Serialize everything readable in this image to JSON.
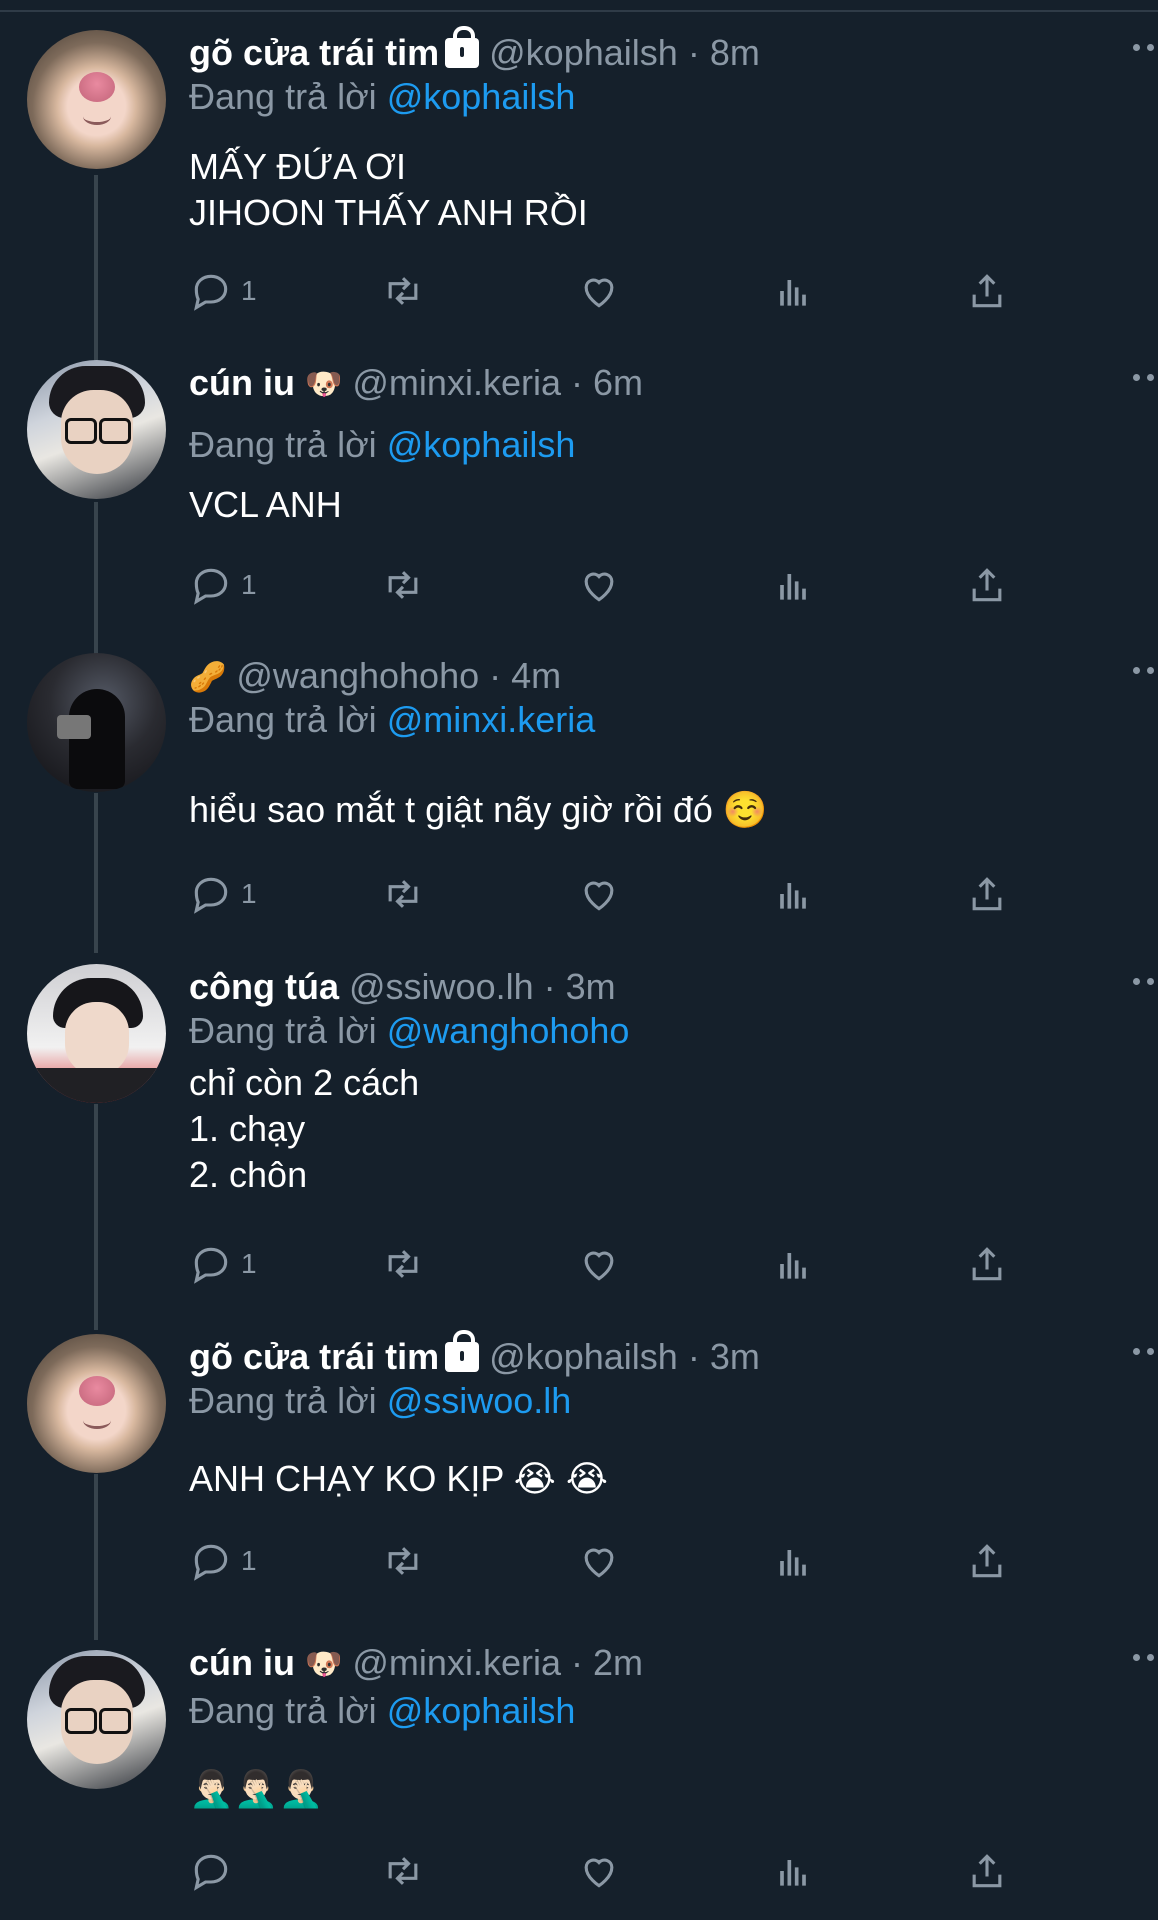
{
  "tweets": [
    {
      "name": "gõ cửa trái tim",
      "handle": "@kophailsh",
      "time": "8m",
      "replying_prefix": "Đang trả lời",
      "replying_to": "@kophailsh",
      "text": " MẤY ĐỨA ƠI\nJIHOON THẤY ANH RỒI",
      "reply_count": "1",
      "name_emoji": "",
      "avatar": "cat"
    },
    {
      "name": "cún iu",
      "handle": "@minxi.keria",
      "time": "6m",
      "replying_prefix": "Đang trả lời",
      "replying_to": "@kophailsh",
      "text": "VCL ANH",
      "reply_count": "1",
      "name_emoji": "🐶",
      "avatar": "glasses"
    },
    {
      "name": "",
      "handle": "@wanghohoho",
      "time": "4m",
      "replying_prefix": "Đang trả lời",
      "replying_to": "@minxi.keria",
      "text": "hiểu sao mắt t giật nãy giờ rồi đó ☺️",
      "reply_count": "1",
      "name_emoji": "🥜",
      "avatar": "dark"
    },
    {
      "name": "công túa",
      "handle": "@ssiwoo.lh",
      "time": "3m",
      "replying_prefix": "Đang trả lời",
      "replying_to": "@wanghohoho",
      "text": "chỉ còn 2 cách\n1. chạy\n2. chôn",
      "reply_count": "1",
      "name_emoji": "",
      "avatar": "red"
    },
    {
      "name": "gõ cửa trái tim",
      "handle": "@kophailsh",
      "time": "3m",
      "replying_prefix": "Đang trả lời",
      "replying_to": "@ssiwoo.lh",
      "text": "ANH CHẠY KO KỊP 😭 😭",
      "reply_count": "1",
      "name_emoji": "",
      "avatar": "cat"
    },
    {
      "name": "cún iu",
      "handle": "@minxi.keria",
      "time": "2m",
      "replying_prefix": "Đang trả lời",
      "replying_to": "@kophailsh",
      "text": "🤦🏻‍♂️🤦🏻‍♂️🤦🏻‍♂️",
      "reply_count": "",
      "name_emoji": "🐶",
      "avatar": "glasses"
    }
  ],
  "separator": "·",
  "colors": {
    "background": "#15202b",
    "muted": "#8b98a5",
    "link": "#1d9bf0",
    "thread_line": "#38444d"
  },
  "icons": [
    "reply-icon",
    "retweet-icon",
    "like-icon",
    "views-icon",
    "share-icon",
    "more-icon",
    "lock-icon"
  ]
}
